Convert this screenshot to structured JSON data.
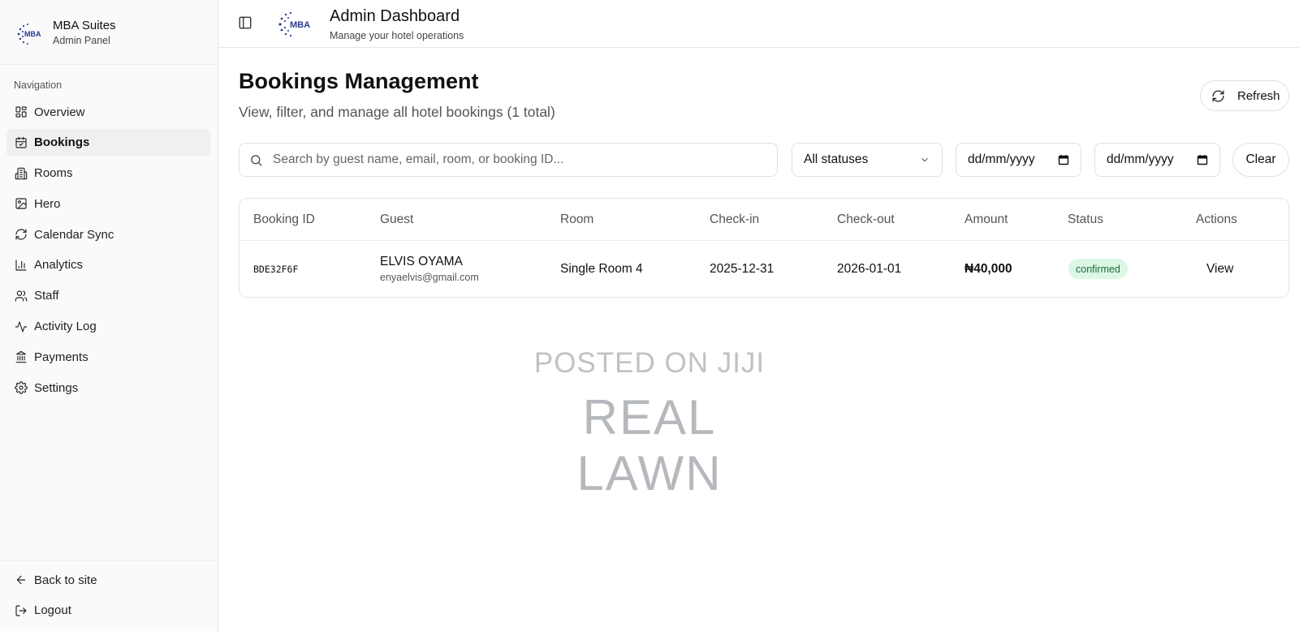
{
  "brand": {
    "name": "MBA Suites",
    "subtitle": "Admin Panel",
    "logo_text": "MBA"
  },
  "header": {
    "title": "Admin Dashboard",
    "subtitle": "Manage your hotel operations",
    "logo_text": "MBA"
  },
  "sidebar": {
    "section_title": "Navigation",
    "items": [
      {
        "label": "Overview",
        "icon": "layout-dashboard-icon",
        "active": false
      },
      {
        "label": "Bookings",
        "icon": "calendar-check-icon",
        "active": true
      },
      {
        "label": "Rooms",
        "icon": "building-icon",
        "active": false
      },
      {
        "label": "Hero",
        "icon": "image-icon",
        "active": false
      },
      {
        "label": "Calendar Sync",
        "icon": "refresh-icon",
        "active": false
      },
      {
        "label": "Analytics",
        "icon": "bar-chart-icon",
        "active": false
      },
      {
        "label": "Staff",
        "icon": "users-icon",
        "active": false
      },
      {
        "label": "Activity Log",
        "icon": "activity-icon",
        "active": false
      },
      {
        "label": "Payments",
        "icon": "landmark-icon",
        "active": false
      },
      {
        "label": "Settings",
        "icon": "gear-icon",
        "active": false
      }
    ],
    "footer": [
      {
        "label": "Back to site",
        "icon": "arrow-left-icon"
      },
      {
        "label": "Logout",
        "icon": "logout-icon"
      }
    ]
  },
  "main": {
    "title": "Bookings Management",
    "subtitle": "View, filter, and manage all hotel bookings (1 total)",
    "refresh_label": "Refresh",
    "search": {
      "placeholder": "Search by guest name, email, room, or booking ID...",
      "value": ""
    },
    "status_filter": {
      "value": "All statuses"
    },
    "date_from": {
      "value": "dd/mm/yyyy"
    },
    "date_to": {
      "value": "dd/mm/yyyy"
    },
    "clear_label": "Clear",
    "table": {
      "columns": [
        "Booking ID",
        "Guest",
        "Room",
        "Check-in",
        "Check-out",
        "Amount",
        "Status",
        "Actions"
      ],
      "rows": [
        {
          "booking_id": "BDE32F6F",
          "guest_name": "ELVIS OYAMA",
          "guest_email": "enyaelvis@gmail.com",
          "room": "Single Room 4",
          "check_in": "2025-12-31",
          "check_out": "2026-01-01",
          "amount": "₦40,000",
          "status": "confirmed",
          "action": "View"
        }
      ]
    }
  },
  "watermark": {
    "line1": "POSTED ON JIJI",
    "line2": "REAL LAWN"
  },
  "colors": {
    "status_confirmed_bg": "#dcf7e5",
    "status_confirmed_text": "#1d6b3a",
    "logo_blue": "#2b3a8f"
  }
}
